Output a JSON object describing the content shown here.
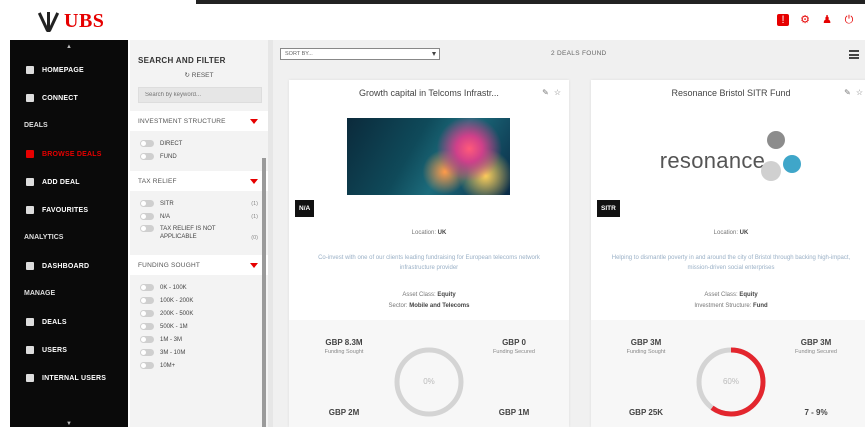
{
  "header": {
    "logo_text": "UBS",
    "icons": [
      "notifications-icon",
      "settings-icon",
      "user-icon",
      "logout-icon"
    ]
  },
  "sidebar": {
    "items": [
      {
        "label": "HOMEPAGE",
        "type": "item",
        "icon": "home-icon"
      },
      {
        "label": "CONNECT",
        "type": "item",
        "icon": "connect-icon"
      },
      {
        "label": "DEALS",
        "type": "heading"
      },
      {
        "label": "BROWSE DEALS",
        "type": "item",
        "icon": "browse-icon",
        "active": true
      },
      {
        "label": "ADD DEAL",
        "type": "item",
        "icon": "add-icon"
      },
      {
        "label": "FAVOURITES",
        "type": "item",
        "icon": "star-icon"
      },
      {
        "label": "ANALYTICS",
        "type": "heading"
      },
      {
        "label": "DASHBOARD",
        "type": "item",
        "icon": "dashboard-icon"
      },
      {
        "label": "MANAGE",
        "type": "heading"
      },
      {
        "label": "DEALS",
        "type": "item",
        "icon": "deals-icon"
      },
      {
        "label": "USERS",
        "type": "item",
        "icon": "users-icon"
      },
      {
        "label": "INTERNAL USERS",
        "type": "item",
        "icon": "internal-users-icon"
      }
    ]
  },
  "filter": {
    "title": "SEARCH AND FILTER",
    "reset": "RESET",
    "search_placeholder": "Search by keyword...",
    "sections": [
      {
        "title": "INVESTMENT STRUCTURE",
        "options": [
          {
            "label": "DIRECT",
            "count": ""
          },
          {
            "label": "FUND",
            "count": ""
          }
        ]
      },
      {
        "title": "TAX RELIEF",
        "options": [
          {
            "label": "SITR",
            "count": "(1)"
          },
          {
            "label": "N/A",
            "count": "(1)"
          },
          {
            "label": "TAX RELIEF IS NOT APPLICABLE",
            "count": "(0)"
          }
        ]
      },
      {
        "title": "FUNDING SOUGHT",
        "options": [
          {
            "label": "0K - 100K",
            "count": ""
          },
          {
            "label": "100K - 200K",
            "count": ""
          },
          {
            "label": "200K - 500K",
            "count": ""
          },
          {
            "label": "500K - 1M",
            "count": ""
          },
          {
            "label": "1M - 3M",
            "count": ""
          },
          {
            "label": "3M - 10M",
            "count": ""
          },
          {
            "label": "10M+",
            "count": ""
          }
        ]
      }
    ]
  },
  "main": {
    "sort_placeholder": "SORT BY...",
    "deals_found": "2 DEALS FOUND"
  },
  "colors": {
    "brand_red": "#e60000",
    "sidebar_bg": "#0a0a0a",
    "ring_red": "#e3262e",
    "ring_grey": "#d4d4d4"
  },
  "deals": [
    {
      "title": "Growth capital in Telcoms Infrastr...",
      "badge": "N/A",
      "location_label": "Location:",
      "location": "UK",
      "description": "Co-invest with one of our clients leading fundraising for European telecoms network infrastructure provider",
      "meta1_label": "Asset Class:",
      "meta1_value": "Equity",
      "meta2_label": "Sector:",
      "meta2_value": "Mobile and Telecoms",
      "stat_tl": {
        "value": "GBP 8.3M",
        "label": "Funding Sought"
      },
      "stat_tr": {
        "value": "GBP 0",
        "label": "Funding Secured"
      },
      "stat_bl": {
        "value": "GBP 2M",
        "label": ""
      },
      "stat_br": {
        "value": "GBP 1M",
        "label": ""
      },
      "progress_pct": 0,
      "progress_label": "0%"
    },
    {
      "title": "Resonance Bristol SITR Fund",
      "badge": "SITR",
      "logo_text": "resonance",
      "location_label": "Location:",
      "location": "UK",
      "description": "Helping to dismantle poverty in and around the city of Bristol through backing high-impact, mission-driven social enterprises",
      "meta1_label": "Asset Class:",
      "meta1_value": "Equity",
      "meta2_label": "Investment Structure:",
      "meta2_value": "Fund",
      "stat_tl": {
        "value": "GBP 3M",
        "label": "Funding Sought"
      },
      "stat_tr": {
        "value": "GBP 3M",
        "label": "Funding Secured"
      },
      "stat_bl": {
        "value": "GBP 25K",
        "label": ""
      },
      "stat_br": {
        "value": "7 - 9%",
        "label": ""
      },
      "progress_pct": 60,
      "progress_label": "60%"
    }
  ]
}
